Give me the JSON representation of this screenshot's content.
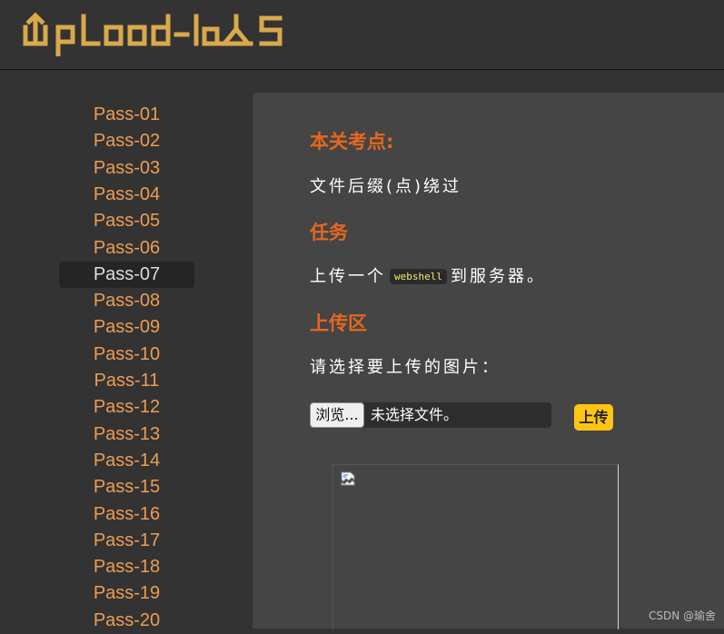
{
  "header": {
    "logo_text": "UpLoad-labS",
    "logo_icon": "upload-arrow-logo"
  },
  "sidebar": {
    "items": [
      {
        "label": "Pass-01"
      },
      {
        "label": "Pass-02"
      },
      {
        "label": "Pass-03"
      },
      {
        "label": "Pass-04"
      },
      {
        "label": "Pass-05"
      },
      {
        "label": "Pass-06"
      },
      {
        "label": "Pass-07",
        "active": true
      },
      {
        "label": "Pass-08"
      },
      {
        "label": "Pass-09"
      },
      {
        "label": "Pass-10"
      },
      {
        "label": "Pass-11"
      },
      {
        "label": "Pass-12"
      },
      {
        "label": "Pass-13"
      },
      {
        "label": "Pass-14"
      },
      {
        "label": "Pass-15"
      },
      {
        "label": "Pass-16"
      },
      {
        "label": "Pass-17"
      },
      {
        "label": "Pass-18"
      },
      {
        "label": "Pass-19"
      },
      {
        "label": "Pass-20"
      }
    ]
  },
  "main": {
    "test_point_heading": "本关考点:",
    "test_point_text": "文件后缀(点)绕过",
    "task_heading": "任务",
    "task_text_before": "上传一个",
    "task_code": "webshell",
    "task_text_after": "到服务器。",
    "upload_heading": "上传区",
    "upload_prompt": "请选择要上传的图片：",
    "browse_label": "浏览...",
    "file_status": "未选择文件。",
    "upload_button": "上传",
    "broken_image_icon": "broken-image-icon"
  },
  "watermark": "CSDN @瑜舍",
  "colors": {
    "accent": "#e5681d",
    "nav": "#ee9c52",
    "logo": "#d9a94a",
    "button": "#ffc512",
    "code_text": "#f6e96c"
  }
}
